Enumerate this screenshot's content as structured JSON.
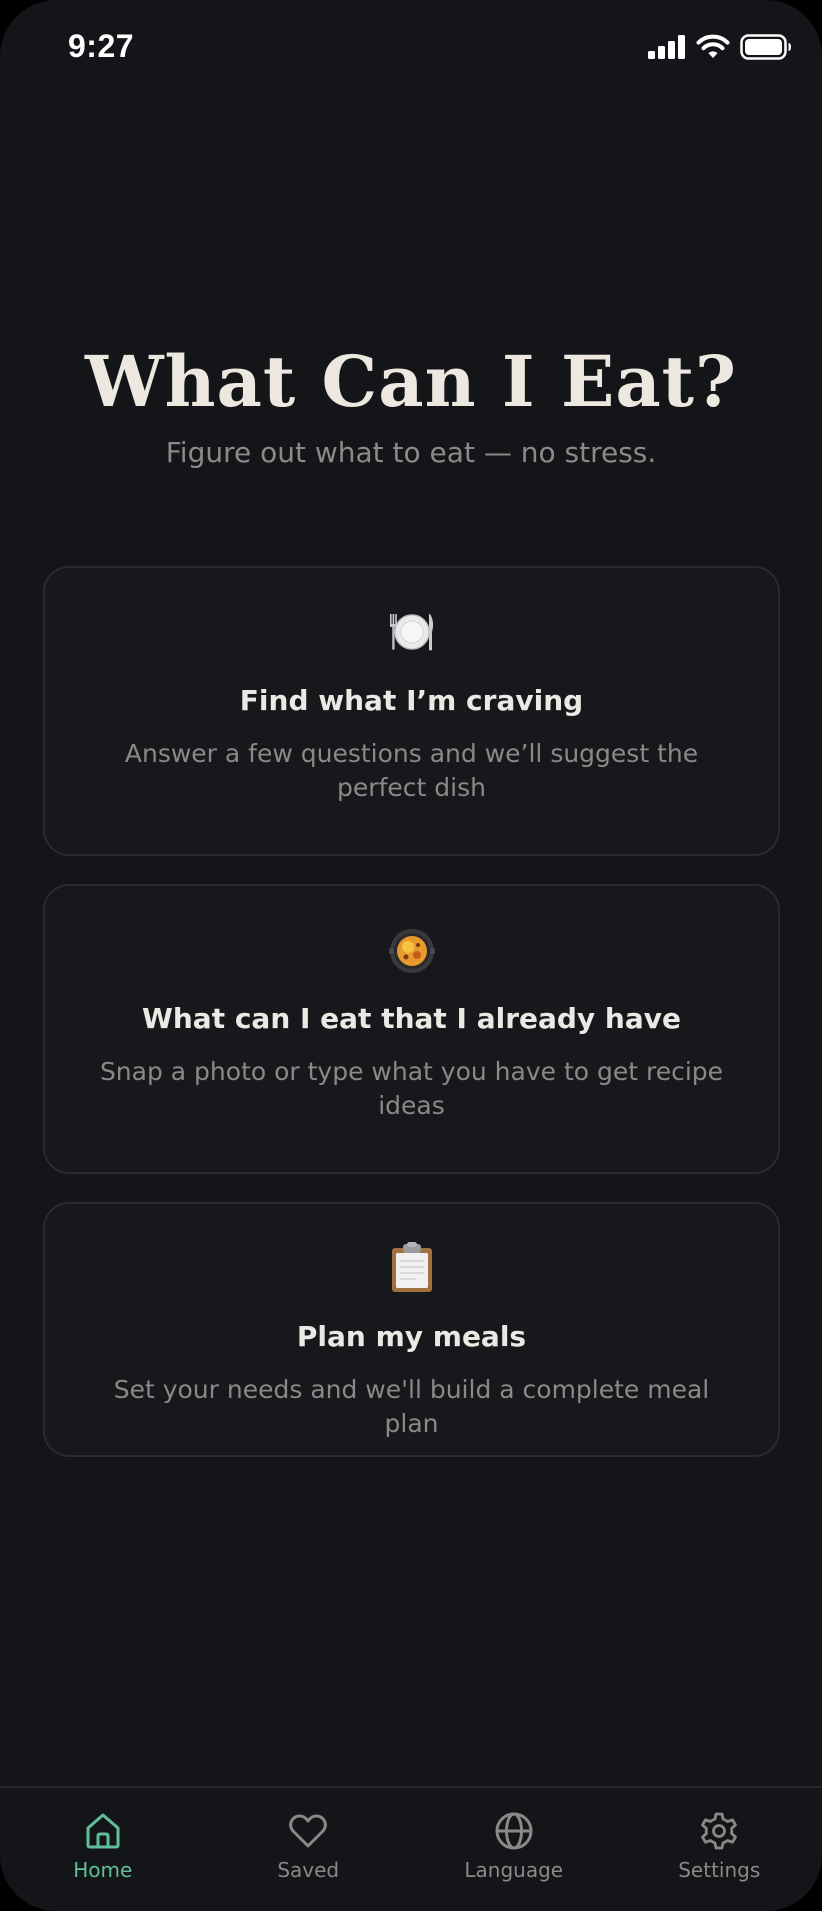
{
  "status_bar": {
    "time": "9:27"
  },
  "header": {
    "title": "What Can I Eat?",
    "subtitle": "Figure out what to eat — no stress."
  },
  "cards": [
    {
      "icon": "plate-cutlery-icon",
      "title": "Find what I’m craving",
      "description": "Answer a few questions and we’ll suggest the perfect dish"
    },
    {
      "icon": "pan-food-icon",
      "title": "What can I eat that I already have",
      "description": "Snap a photo or type what you have to get recipe ideas"
    },
    {
      "icon": "clipboard-icon",
      "title": "Plan my meals",
      "description": "Set your needs and we'll build a complete meal plan"
    }
  ],
  "tab_bar": {
    "active_color": "#5fbf98",
    "inactive_color": "#8a8987",
    "tabs": [
      {
        "label": "Home",
        "icon": "home-icon",
        "active": true
      },
      {
        "label": "Saved",
        "icon": "heart-icon",
        "active": false
      },
      {
        "label": "Language",
        "icon": "globe-icon",
        "active": false
      },
      {
        "label": "Settings",
        "icon": "gear-icon",
        "active": false
      }
    ]
  }
}
